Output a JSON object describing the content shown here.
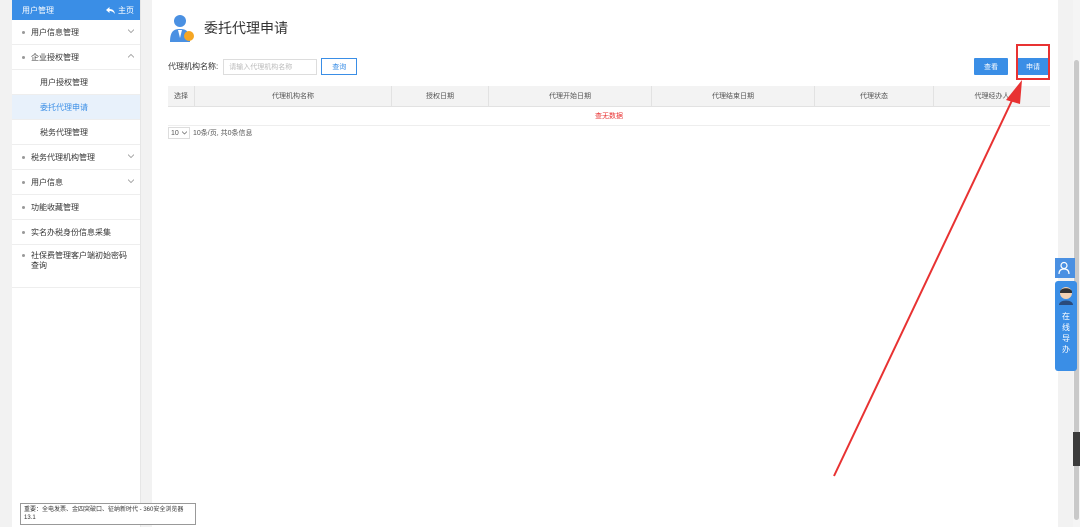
{
  "sidebar": {
    "header_title": "用户管理",
    "home_label": "主页",
    "items": [
      {
        "label": "用户信息管理"
      },
      {
        "label": "企业授权管理"
      },
      {
        "label": "用户授权管理"
      },
      {
        "label": "委托代理申请"
      },
      {
        "label": "税务代理管理"
      },
      {
        "label": "税务代理机构管理"
      },
      {
        "label": "用户信息"
      },
      {
        "label": "功能收藏管理"
      },
      {
        "label": "实名办税身份信息采集"
      },
      {
        "label": "社保费管理客户端初始密码查询"
      }
    ]
  },
  "main": {
    "title": "委托代理申请",
    "filter_label": "代理机构名称:",
    "filter_placeholder": "请输入代理机构名称",
    "query_button": "查询",
    "view_button": "查看",
    "apply_button": "申请"
  },
  "table": {
    "columns": [
      "选择",
      "代理机构名称",
      "授权日期",
      "代理开始日期",
      "代理结束日期",
      "代理状态",
      "代理经办人"
    ],
    "empty_text": "查无数据"
  },
  "pager": {
    "page_size": "10",
    "summary": "10条/页, 共0条信息"
  },
  "tooltip": {
    "text": "重要：全电发票、金四突破口、征纳新时代 - 360安全浏览器 13.1"
  },
  "float": {
    "guide_text": "在线导办"
  },
  "colors": {
    "accent": "#3a8ee6",
    "highlight": "#e83232"
  }
}
